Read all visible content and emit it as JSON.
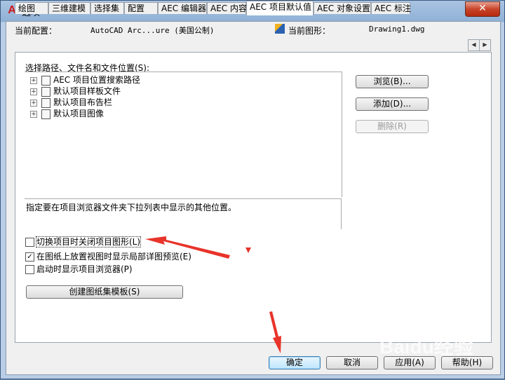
{
  "window": {
    "title": "选项",
    "close_glyph": "✕",
    "app_icon": "autocad-icon"
  },
  "config": {
    "current_profile_label": "当前配置：",
    "current_profile_value": "AutoCAD Arc...ure (美国公制)",
    "current_drawing_label": "当前图形：",
    "current_drawing_value": "Drawing1.dwg"
  },
  "tabs": [
    "绘图",
    "三维建模",
    "选择集",
    "配置",
    "AEC 编辑器",
    "AEC 内容",
    "AEC 项目默认值",
    "AEC 对象设置",
    "AEC 标注"
  ],
  "active_tab": "AEC 项目默认值",
  "tab_scroll": {
    "left": "◀",
    "right": "▶"
  },
  "tree": {
    "label": "选择路径、文件名和文件位置(S):",
    "items": [
      "AEC 项目位置搜索路径",
      "默认项目样板文件",
      "默认项目布告栏",
      "默认项目图像"
    ]
  },
  "side_buttons": {
    "browse": "浏览(B)...",
    "add": "添加(D)...",
    "remove": "删除(R)"
  },
  "description": "指定要在项目浏览器文件夹下拉列表中显示的其他位置。",
  "options": [
    {
      "label": "切换项目时关闭项目图形(L)",
      "checked": false
    },
    {
      "label": "在图纸上放置视图时显示局部详图预览(E)",
      "checked": true
    },
    {
      "label": "启动时显示项目浏览器(P)",
      "checked": false
    }
  ],
  "create_sheet_button": "创建图纸集模板(S)",
  "footer": {
    "ok": "确定",
    "cancel": "取消",
    "apply": "应用(A)",
    "help": "帮助(H)"
  },
  "watermark": "Baidu经验",
  "colors": {
    "accent_red": "#e8342a",
    "close_red": "#c8442a"
  }
}
